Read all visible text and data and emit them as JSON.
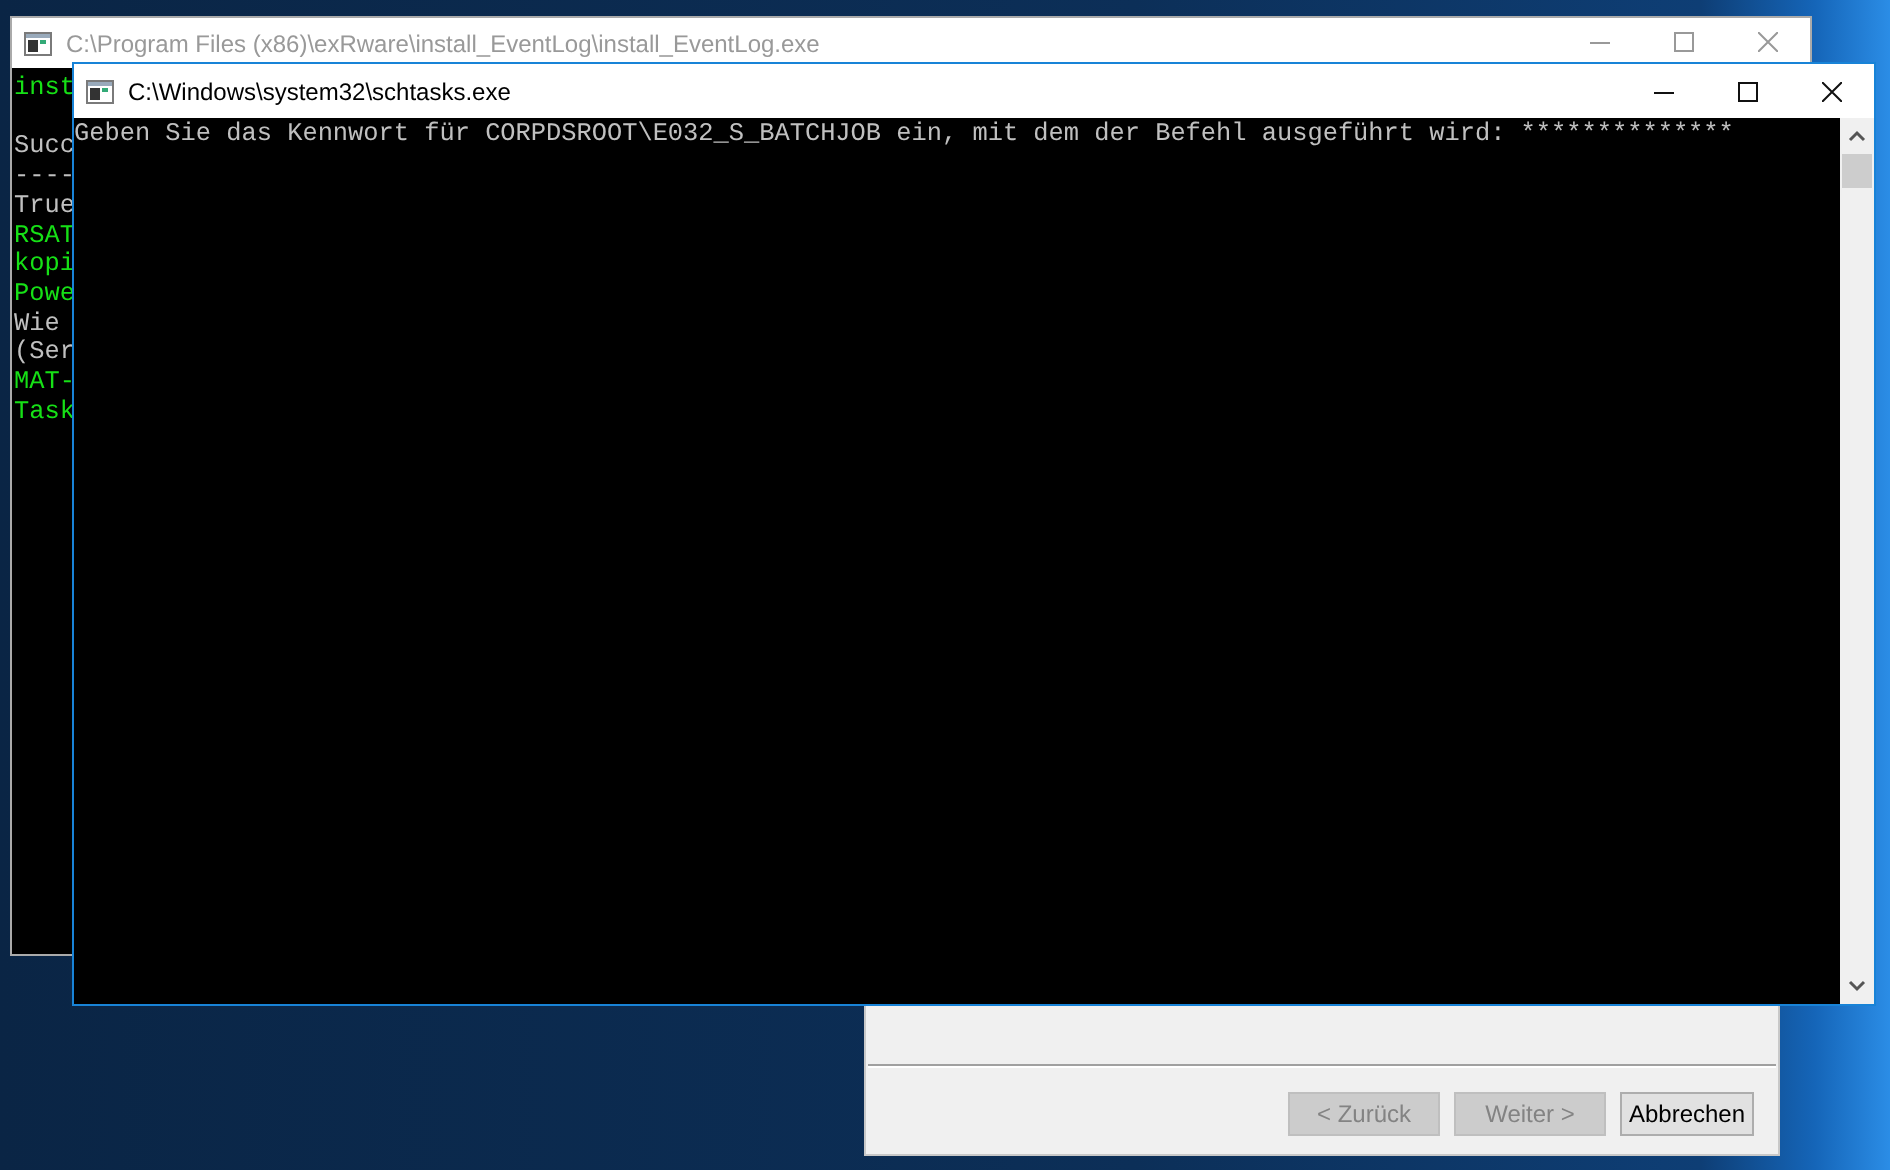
{
  "back_window": {
    "title": "C:\\Program Files (x86)\\exRware\\install_EventLog\\install_EventLog.exe",
    "active": false,
    "lines": [
      {
        "text": "inst",
        "color": "#16e016",
        "blank_after": true
      },
      {
        "text": "Succ",
        "color": "#c0c0c0"
      },
      {
        "text": "----",
        "color": "#c0c0c0"
      },
      {
        "text": "True",
        "color": "#c0c0c0"
      },
      {
        "text": "RSAT",
        "color": "#16e016"
      },
      {
        "text": "kopi",
        "color": "#16e016"
      },
      {
        "text": "Powe",
        "color": "#16e016"
      },
      {
        "text": "Wie",
        "color": "#c0c0c0"
      },
      {
        "text": "(Ser",
        "color": "#c0c0c0"
      },
      {
        "text": "MAT-",
        "color": "#16e016"
      },
      {
        "text": "Task",
        "color": "#16e016"
      }
    ]
  },
  "wizard": {
    "buttons": [
      {
        "label": "< Zurück",
        "disabled": true
      },
      {
        "label": "Weiter >",
        "disabled": true
      },
      {
        "label": "Abbrechen",
        "disabled": false
      }
    ]
  },
  "front_window": {
    "title": "C:\\Windows\\system32\\schtasks.exe",
    "active": true,
    "lines": [
      "Geben Sie das Kennwort für CORPDSROOT\\E032_S_BATCHJOB ein, mit dem der Befehl ausgeführt wird: **************"
    ]
  }
}
